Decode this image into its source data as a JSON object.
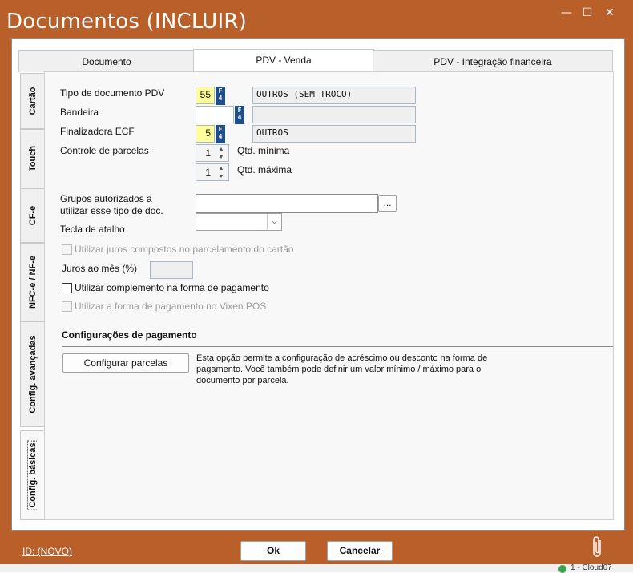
{
  "window": {
    "title": "Documentos (INCLUIR)",
    "minimize_glyph": "—",
    "maximize_glyph": "☐",
    "close_glyph": "✕"
  },
  "tabs_top": [
    {
      "label": "Documento",
      "active": false
    },
    {
      "label": "PDV - Venda",
      "active": true
    },
    {
      "label": "PDV - Integração financeira",
      "active": false
    }
  ],
  "tabs_side": [
    {
      "label": "Cartão",
      "active": false
    },
    {
      "label": "Touch",
      "active": false
    },
    {
      "label": "CF-e",
      "active": false
    },
    {
      "label": "NFC-e / NF-e",
      "active": false
    },
    {
      "label": "Config. avançadas",
      "active": false
    },
    {
      "label": "Config. básicas",
      "active": true
    }
  ],
  "form": {
    "tipo_documento": {
      "label": "Tipo de documento PDV",
      "code": "55",
      "key": "F4",
      "description": "OUTROS (SEM TROCO)"
    },
    "bandeira": {
      "label": "Bandeira",
      "code": "",
      "key": "F4",
      "description": ""
    },
    "finalizadora": {
      "label": "Finalizadora ECF",
      "code": "5",
      "key": "F4",
      "description": "OUTROS"
    },
    "controle_parcelas": {
      "label": "Controle de parcelas",
      "min_value": "1",
      "min_label": "Qtd. mínima",
      "max_value": "1",
      "max_label": "Qtd. máxima"
    },
    "grupos": {
      "label_line1": "Grupos autorizados a",
      "label_line2": "utilizar esse tipo de doc.",
      "value": "",
      "browse_label": "..."
    },
    "tecla_atalho": {
      "label": "Tecla de atalho",
      "value": ""
    },
    "juros_compostos": {
      "label": "Utilizar juros compostos no parcelamento do cartão",
      "checked": false,
      "enabled": false
    },
    "juros_mes": {
      "label": "Juros ao mês (%)",
      "value": ""
    },
    "complemento": {
      "label": "Utilizar complemento na forma de pagamento",
      "checked": false,
      "enabled": true
    },
    "vixen": {
      "label": "Utilizar a forma de pagamento no Vixen POS",
      "checked": false,
      "enabled": false
    }
  },
  "pagamento": {
    "section_title": "Configurações de pagamento",
    "button_label": "Configurar parcelas",
    "description": [
      "Esta opção permite a configuração de acréscimo ou desconto na forma de",
      "pagamento. Você também pode definir um valor mínimo / máximo para o",
      "documento por parcela."
    ]
  },
  "footer": {
    "id_label": "ID: (NOVO)",
    "ok_label": "Ok",
    "cancel_label": "Cancelar",
    "attach_icon": "paperclip-icon"
  },
  "taskbar": {
    "text": "1 - Cloud07"
  },
  "colors": {
    "frame": "#b95f2a",
    "required_field": "#ffff99",
    "fkey_badge": "#1f4e8c"
  }
}
